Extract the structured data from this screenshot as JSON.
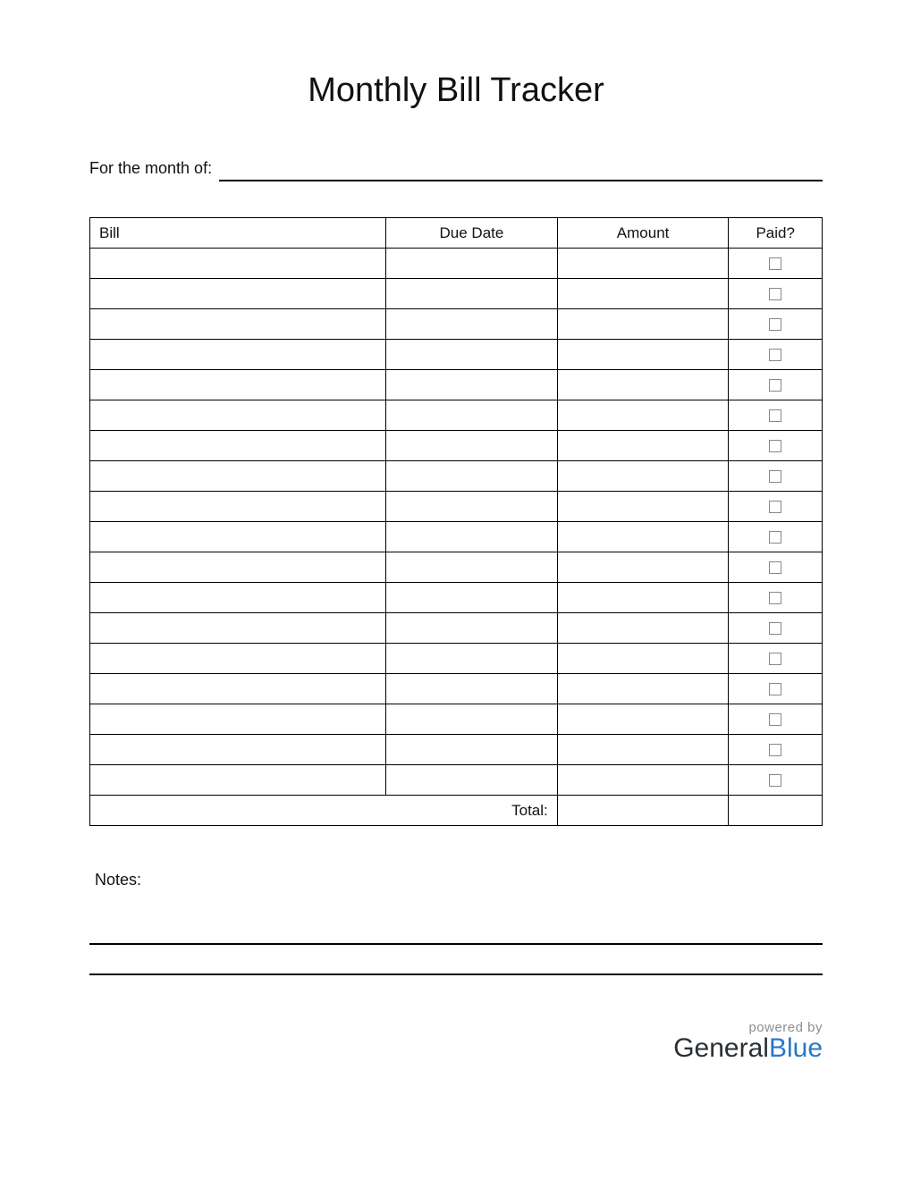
{
  "title": "Monthly Bill Tracker",
  "month_label": "For the month of:",
  "month_value": "",
  "columns": {
    "bill": "Bill",
    "due": "Due Date",
    "amount": "Amount",
    "paid": "Paid?"
  },
  "rows": [
    {
      "bill": "",
      "due": "",
      "amount": "",
      "paid": false
    },
    {
      "bill": "",
      "due": "",
      "amount": "",
      "paid": false
    },
    {
      "bill": "",
      "due": "",
      "amount": "",
      "paid": false
    },
    {
      "bill": "",
      "due": "",
      "amount": "",
      "paid": false
    },
    {
      "bill": "",
      "due": "",
      "amount": "",
      "paid": false
    },
    {
      "bill": "",
      "due": "",
      "amount": "",
      "paid": false
    },
    {
      "bill": "",
      "due": "",
      "amount": "",
      "paid": false
    },
    {
      "bill": "",
      "due": "",
      "amount": "",
      "paid": false
    },
    {
      "bill": "",
      "due": "",
      "amount": "",
      "paid": false
    },
    {
      "bill": "",
      "due": "",
      "amount": "",
      "paid": false
    },
    {
      "bill": "",
      "due": "",
      "amount": "",
      "paid": false
    },
    {
      "bill": "",
      "due": "",
      "amount": "",
      "paid": false
    },
    {
      "bill": "",
      "due": "",
      "amount": "",
      "paid": false
    },
    {
      "bill": "",
      "due": "",
      "amount": "",
      "paid": false
    },
    {
      "bill": "",
      "due": "",
      "amount": "",
      "paid": false
    },
    {
      "bill": "",
      "due": "",
      "amount": "",
      "paid": false
    },
    {
      "bill": "",
      "due": "",
      "amount": "",
      "paid": false
    },
    {
      "bill": "",
      "due": "",
      "amount": "",
      "paid": false
    }
  ],
  "total_label": "Total:",
  "total_value": "",
  "notes_label": "Notes:",
  "notes_lines": [
    "",
    ""
  ],
  "footer": {
    "powered_by": "powered by",
    "brand_general": "General",
    "brand_blue": "Blue"
  }
}
